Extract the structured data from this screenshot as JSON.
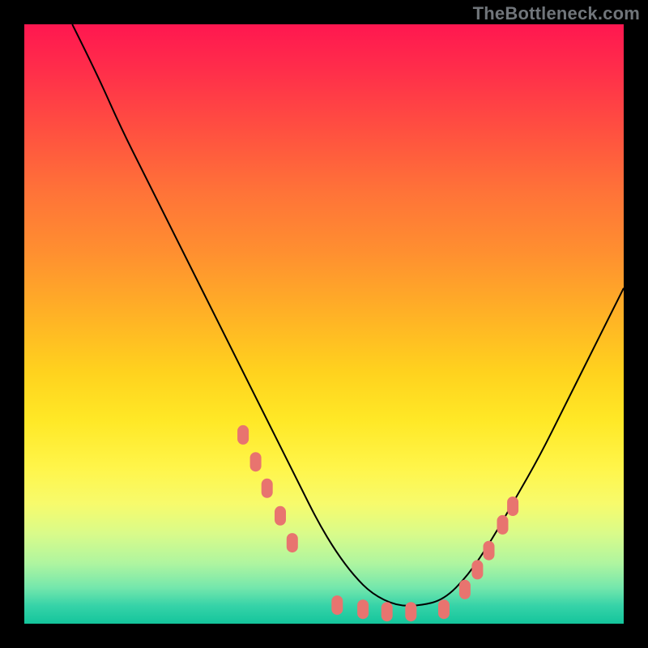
{
  "watermark": "TheBottleneck.com",
  "chart_data": {
    "type": "line",
    "title": "",
    "xlabel": "",
    "ylabel": "",
    "xlim": [
      0,
      100
    ],
    "ylim": [
      0,
      100
    ],
    "grid": false,
    "series": [
      {
        "name": "curve",
        "x": [
          8,
          12,
          16,
          20,
          24,
          28,
          32,
          36,
          40,
          43,
          46,
          49,
          52,
          55,
          58,
          62,
          66,
          70,
          74,
          78,
          82,
          86,
          90,
          94,
          98,
          100
        ],
        "y": [
          100,
          92,
          83,
          75,
          67,
          59,
          51,
          43,
          35,
          29,
          23,
          17,
          12,
          8,
          5,
          3,
          3,
          4,
          8,
          14,
          21,
          28,
          36,
          44,
          52,
          56
        ]
      }
    ],
    "markers": [
      {
        "x": 36.5,
        "y": 31.5
      },
      {
        "x": 38.6,
        "y": 27.0
      },
      {
        "x": 40.5,
        "y": 22.6
      },
      {
        "x": 42.7,
        "y": 18.0
      },
      {
        "x": 44.7,
        "y": 13.5
      },
      {
        "x": 52.2,
        "y": 3.1
      },
      {
        "x": 56.5,
        "y": 2.4
      },
      {
        "x": 60.5,
        "y": 2.0
      },
      {
        "x": 64.5,
        "y": 2.0
      },
      {
        "x": 70.0,
        "y": 2.4
      },
      {
        "x": 73.5,
        "y": 5.7
      },
      {
        "x": 75.6,
        "y": 9.0
      },
      {
        "x": 77.5,
        "y": 12.2
      },
      {
        "x": 79.8,
        "y": 16.5
      },
      {
        "x": 81.5,
        "y": 19.6
      }
    ],
    "marker_color": "#e8746f",
    "curve_color": "#000000",
    "background_gradient": [
      "#ff1750",
      "#ff5140",
      "#ff8f30",
      "#ffd21e",
      "#fff54a",
      "#d9fb8a",
      "#74e7ac",
      "#14c59c"
    ]
  }
}
